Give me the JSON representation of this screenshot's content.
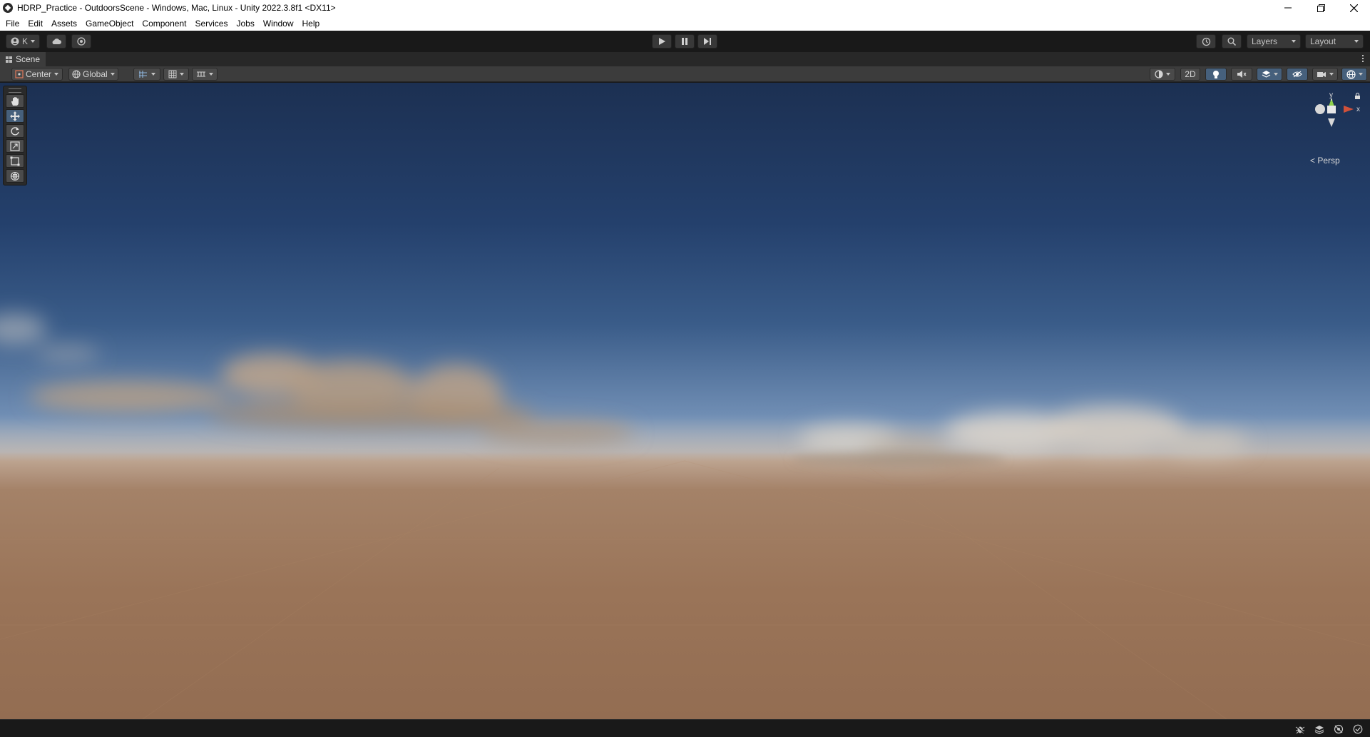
{
  "window": {
    "title": "HDRP_Practice - OutdoorsScene - Windows, Mac, Linux - Unity 2022.3.8f1 <DX11>",
    "controls": {
      "minimize": "—",
      "maximize": "❐",
      "close": "✕"
    }
  },
  "menu": [
    "File",
    "Edit",
    "Assets",
    "GameObject",
    "Component",
    "Services",
    "Jobs",
    "Window",
    "Help"
  ],
  "toolbar": {
    "account_label": "K",
    "layers_label": "Layers",
    "layout_label": "Layout",
    "icons": [
      "account-icon",
      "cloud-icon",
      "collab-icon",
      "play-icon",
      "pause-icon",
      "step-icon",
      "history-icon",
      "search-icon"
    ]
  },
  "scene_tab": {
    "label": "Scene"
  },
  "scene_toolbar": {
    "pivot_mode": "Center",
    "pivot_rotation": "Global",
    "mode_2d": "2D"
  },
  "gizmo": {
    "y_label": "y",
    "x_label": "x",
    "view_label": "< Persp"
  },
  "colors": {
    "editor_bg": "#191919",
    "panel_bg": "#3c3c3c",
    "active_button": "#46607c",
    "sky_top": "#1c3052",
    "ground": "#9a7458"
  }
}
